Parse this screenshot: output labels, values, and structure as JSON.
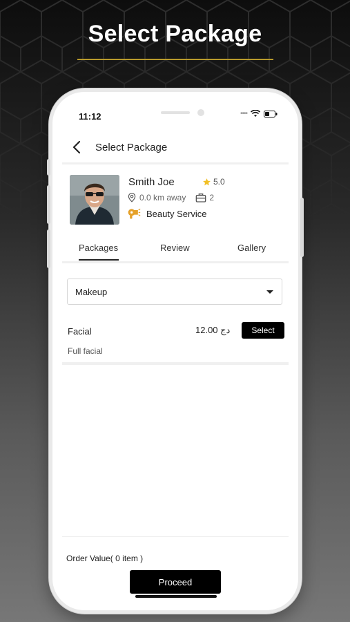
{
  "headline": "Select Package",
  "colors": {
    "accent_gold": "#b89a2c",
    "star": "#f2c026",
    "primary_button": "#000000"
  },
  "status_bar": {
    "time": "11:12"
  },
  "app_bar": {
    "back_icon": "chevron-left-icon",
    "title": "Select Package"
  },
  "provider": {
    "name": "Smith Joe",
    "rating": "5.0",
    "distance": "0.0 km away",
    "jobs_count": "2",
    "service": "Beauty Service",
    "icons": {
      "rating": "star-icon",
      "distance": "location-pin-icon",
      "jobs": "briefcase-icon",
      "service": "hair-dryer-icon"
    }
  },
  "tabs": [
    {
      "label": "Packages",
      "active": true
    },
    {
      "label": "Review",
      "active": false
    },
    {
      "label": "Gallery",
      "active": false
    }
  ],
  "category_select": {
    "value": "Makeup"
  },
  "packages": [
    {
      "name": "Facial",
      "price": "12.00 دج",
      "button_label": "Select",
      "description": "Full facial"
    }
  ],
  "footer": {
    "order_value": "Order Value( 0 item )",
    "proceed_label": "Proceed"
  }
}
